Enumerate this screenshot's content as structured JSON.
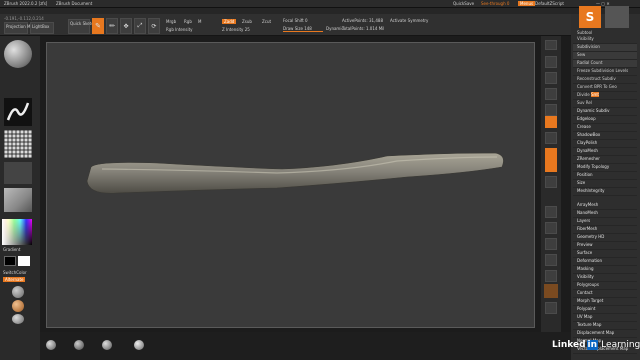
{
  "titlebar": {
    "title": "ZBrush 2022.0.2 [zfs]",
    "doc": "ZBrush Document",
    "quicksave": "QuickSave",
    "seethrough": "See-through 0",
    "menus": "Menus",
    "script": "DefaultZScript"
  },
  "toolbar": {
    "coords": "-0.191,-0.112,0.214",
    "lightbox_btn": "LightBox",
    "projection_label": "Projection\nMaster",
    "quicksketch": "Quick\nSketch",
    "edit": "Edit",
    "draw": "Draw",
    "move": "Move",
    "scale": "Scale",
    "rotate": "Rotate",
    "mrgb": "Mrgb",
    "rgb": "Rgb",
    "m": "M",
    "zadd": "Zadd",
    "zsub": "Zsub",
    "zcut": "Zcut",
    "focal_shift": "Focal Shift 0",
    "draw_size": "Draw Size 148",
    "dynamic": "Dynamic",
    "z_intensity": "Z Intensity 25",
    "rgb_intensity": "Rgb Intensity",
    "active_points": "ActivePoints: 31,488",
    "total_points": "TotalPoints: 1.014 Mil",
    "activate_symmetry": "Activate Symmetry"
  },
  "right_panel": {
    "subtool_title": "Subtool",
    "items": [
      "Visibility",
      "Subdivision",
      "Sew",
      "Radial Count",
      "Freeze Subdivision Levels",
      "Reconstruct Subdiv",
      "Convert BPR To Geo",
      "Divide",
      "Dynamic Subdiv",
      "Edgeloop",
      "Crease",
      "ShadowBox",
      "ClayPolish",
      "DynaMesh",
      "ZRemesher",
      "Modify Topology",
      "Position",
      "Size",
      "MeshIntegrity",
      "ArrayMesh",
      "NanoMesh",
      "Layers",
      "FiberMesh",
      "Geometry HD",
      "Preview",
      "Surface",
      "Deformation",
      "Masking",
      "Visibility",
      "Polygroups",
      "Contact",
      "Morph Target",
      "Polypaint",
      "UV Map",
      "Texture Map",
      "Displacement Map",
      "Normal Map",
      "Vector Displacement Map"
    ],
    "smt": "Smt",
    "suv": "Suv",
    "rel": "Rel"
  },
  "left_shelf": {
    "gradient_label": "Gradient",
    "switchcolor_label": "SwitchColor",
    "alternate_label": "Alternate"
  },
  "watermark": {
    "linked": "Linked",
    "in": "in",
    "learning": "Learning"
  }
}
